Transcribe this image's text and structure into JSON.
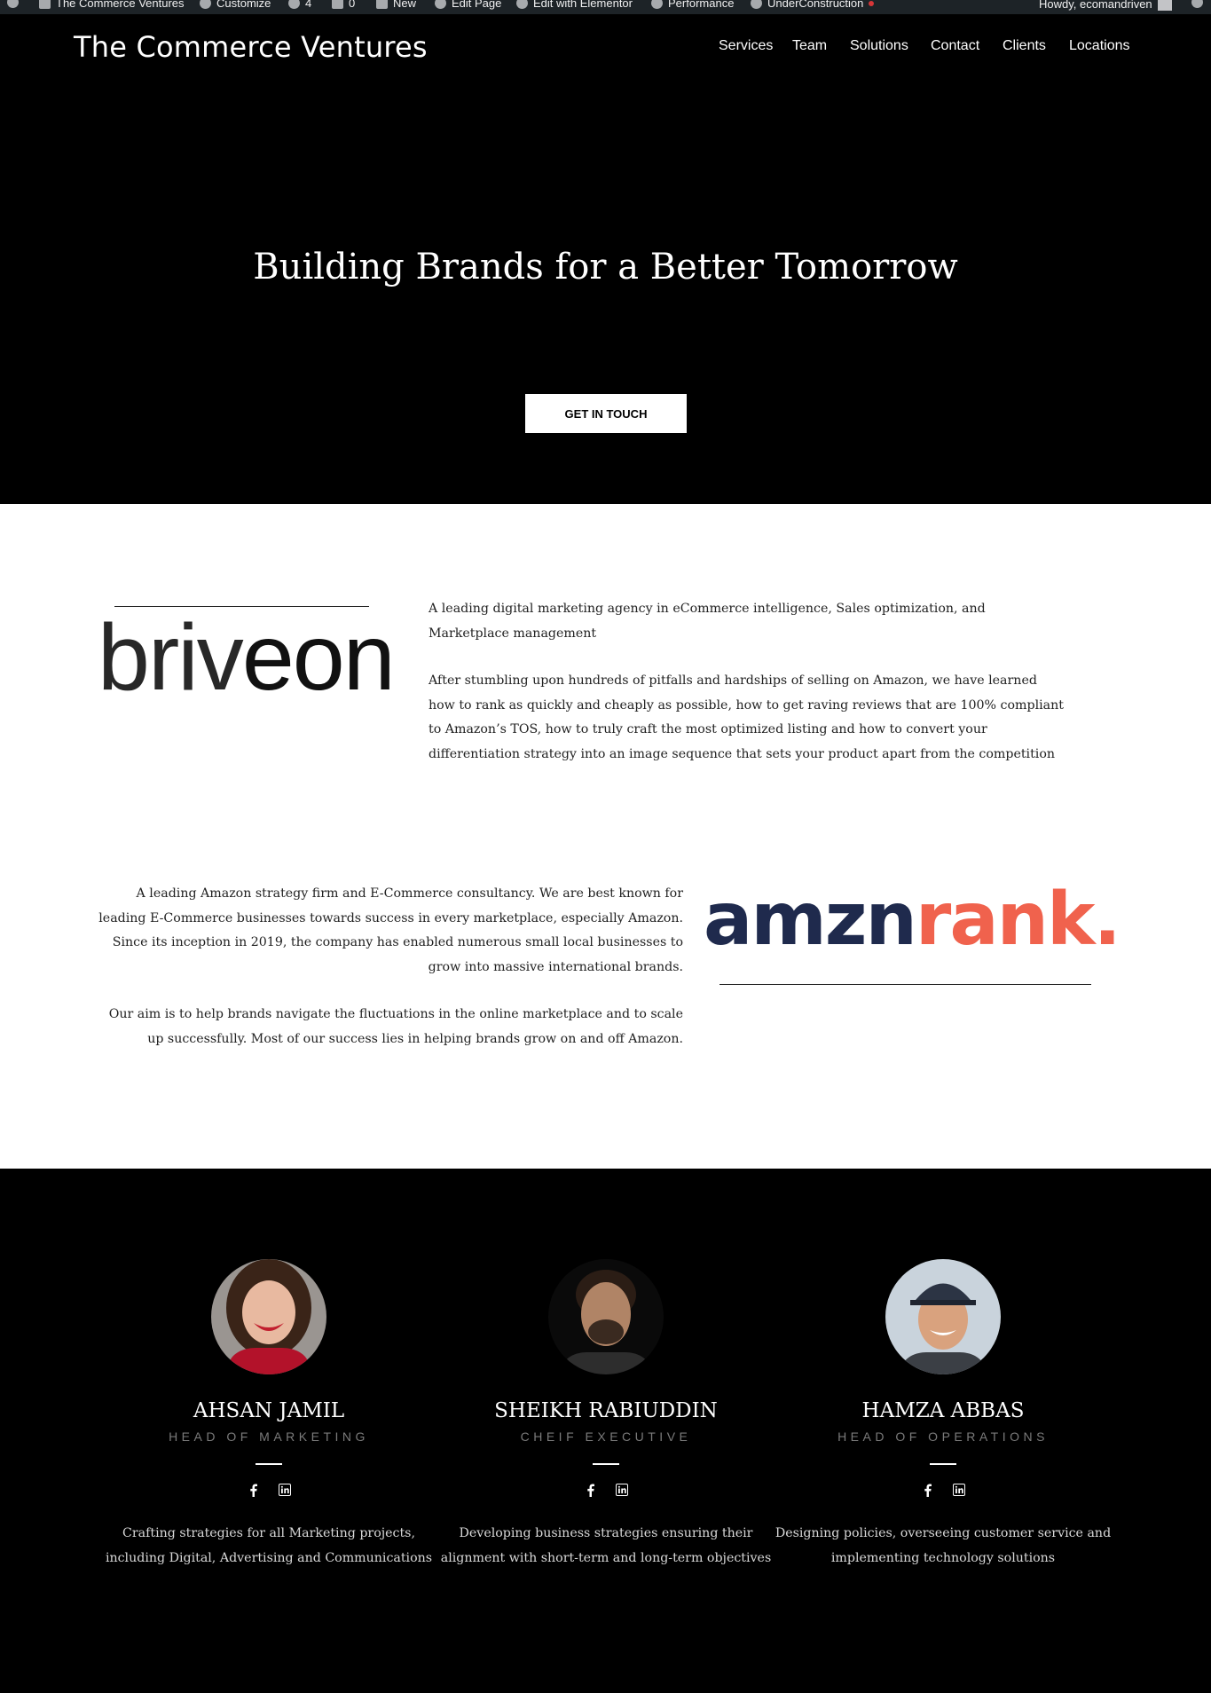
{
  "admin_bar": {
    "items": [
      "The Commerce Ventures",
      "Customize",
      "4",
      "0",
      "New",
      "Edit Page",
      "Edit with Elementor",
      "Performance",
      "UnderConstruction"
    ],
    "greeting": "Howdy, ecomandriven"
  },
  "header": {
    "site_title": "The Commerce Ventures",
    "nav": [
      "Services",
      "Team",
      "Solutions",
      "Contact",
      "Clients",
      "Locations"
    ]
  },
  "hero": {
    "title": "Building Brands for a Better Tomorrow",
    "cta": "GET IN TOUCH"
  },
  "briveon": {
    "logo_thin": "briv",
    "logo_bold": "eon",
    "p1": "A leading digital marketing agency in eCommerce intelligence, Sales optimization, and Marketplace management",
    "p2": "After stumbling upon hundreds of pitfalls and hardships of selling on Amazon, we have learned how to rank as quickly and cheaply as possible, how to get raving reviews that are 100% compliant to Amazon’s TOS, how to truly craft the most optimized listing and how to convert your differentiation strategy into an image sequence that sets your product apart from the competition"
  },
  "amznrank": {
    "logo_dark": "amzn",
    "logo_accent": "rank.",
    "color_dark": "#1f2a4d",
    "color_accent": "#f0624d",
    "p1": "A leading Amazon strategy firm and E-Commerce consultancy. We are best known for leading E-Commerce businesses towards success in every marketplace, especially Amazon. Since its inception in 2019, the company has enabled numerous small local businesses to grow into massive international brands.",
    "p2": "Our aim is to help brands navigate the fluctuations in the online marketplace and to scale up successfully. Most of our success lies in helping brands grow on and off Amazon."
  },
  "team": [
    {
      "name": "AHSAN JAMIL",
      "role": "HEAD OF MARKETING",
      "desc": "Crafting strategies for all Marketing projects, including Digital, Advertising and Communications"
    },
    {
      "name": "SHEIKH RABIUDDIN",
      "role": "CHEIF EXECUTIVE",
      "desc": "Developing business strategies ensuring their alignment with short-term and long-term objectives"
    },
    {
      "name": "HAMZA ABBAS",
      "role": "HEAD OF OPERATIONS",
      "desc": "Designing policies, overseeing customer service and implementing technology solutions"
    }
  ]
}
